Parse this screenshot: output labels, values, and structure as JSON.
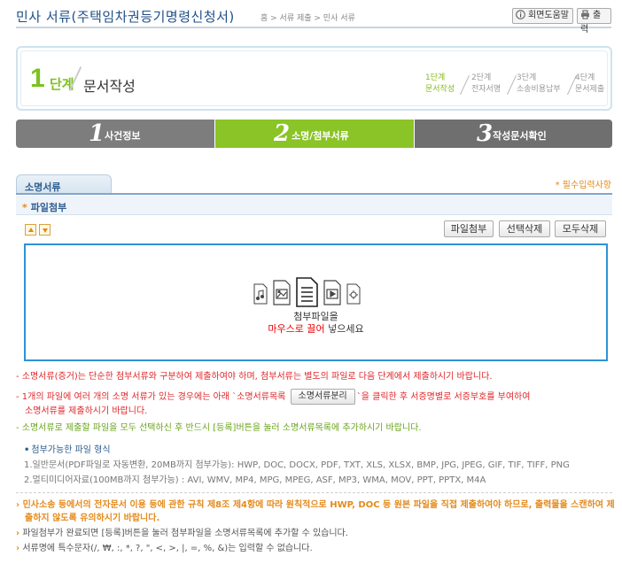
{
  "header": {
    "title": "민사 서류(주택임차권등기명령신청서)",
    "breadcrumb": "홈 > 서류 제출 > 민사 서류",
    "help_button": "회면도움말",
    "print_button": "출력"
  },
  "stepbox": {
    "num": "1",
    "step_word": "단계",
    "name": "문서작성",
    "steps": [
      {
        "top": "1단계",
        "bottom": "문서작성"
      },
      {
        "top": "2단계",
        "bottom": "전자서명"
      },
      {
        "top": "3단계",
        "bottom": "소송비용납부"
      },
      {
        "top": "4단계",
        "bottom": "문서제출"
      }
    ]
  },
  "tabs": [
    {
      "num": "1",
      "label": "사건정보"
    },
    {
      "num": "2",
      "label": "소명/첨부서류"
    },
    {
      "num": "3",
      "label": "작성문서확인"
    }
  ],
  "section": {
    "title": "소명서류",
    "required_note": "* 필수입력사항",
    "subtitle": "파일첨부",
    "subtitle_mark": "*"
  },
  "actions": {
    "attach": "파일첨부",
    "delete_selected": "선택삭제",
    "delete_all": "모두삭제"
  },
  "dropzone": {
    "line1": "첨부파일을",
    "line2_red": "마우스로 끌어",
    "line2_rest": " 넣으세요"
  },
  "notes": {
    "n1": "- 소명서류(증거)는 단순한 첨부서류와 구분하여 제출하여야 하며, 첨부서류는 별도의 파일로 다음 단계에서 제출하시기 바랍니다.",
    "n2_pre": "- 1개의 파일에 여러 개의 소명 서류가 있는 경우에는 아래 `소명서류목록 ",
    "n2_btn": "소명서류분리",
    "n2_post": "`을 클릭한 후 서증명별로 서증부호를 부여하여",
    "n2_cont": "소명서류를 제출하시기 바랍니다.",
    "n3": "- 소명서류로 제출할 파일을 모두 선택하신 후 반드시 [등록]버튼을 눌러 소명서류목록에 추가하시기 바랍니다."
  },
  "formats": {
    "title": "첨부가능한 파일 형식",
    "bullet": "•",
    "f1": "1.일반문서(PDF파일로 자동변환, 20MB까지 첨부가능): HWP, DOC, DOCX, PDF, TXT, XLS, XLSX, BMP, JPG, JPEG, GIF, TIF, TIFF, PNG",
    "f2": "2.멀티미디어자료(100MB까지 첨부가능) : AVI, WMV, MP4, MPG, MPEG, ASF, MP3, WMA, MOV, PPT, PPTX, M4A"
  },
  "bottom": {
    "arrow": "›",
    "warn": "민사소송 등에서의 전자문서 이용 등에 관한 규칙 제8조 제4항에 따라 원칙적으로 HWP, DOC 등 원본 파일을 직접 제출하여야 하므로, 출력물을 스캔하여 제출하지 않도록 유의하시기 바랍니다.",
    "b2": "파일첨부가 완료되면 [등록]버튼을 눌러 첨부파일을 소명서류목록에 추가할 수 있습니다.",
    "b3": "서류명에 특수문자(/, ₩, :, *, ?, \", <, >, |, =, %, &)는 입력할 수 없습니다."
  },
  "colors": {
    "title_blue": "#1f4f86",
    "step_green": "#8ac426",
    "tab_gray": "#7d7d7d",
    "drop_border": "#2e92d6",
    "note_red": "#e0272b",
    "note_green": "#6aa51a",
    "accent_orange": "#e48a1b"
  }
}
